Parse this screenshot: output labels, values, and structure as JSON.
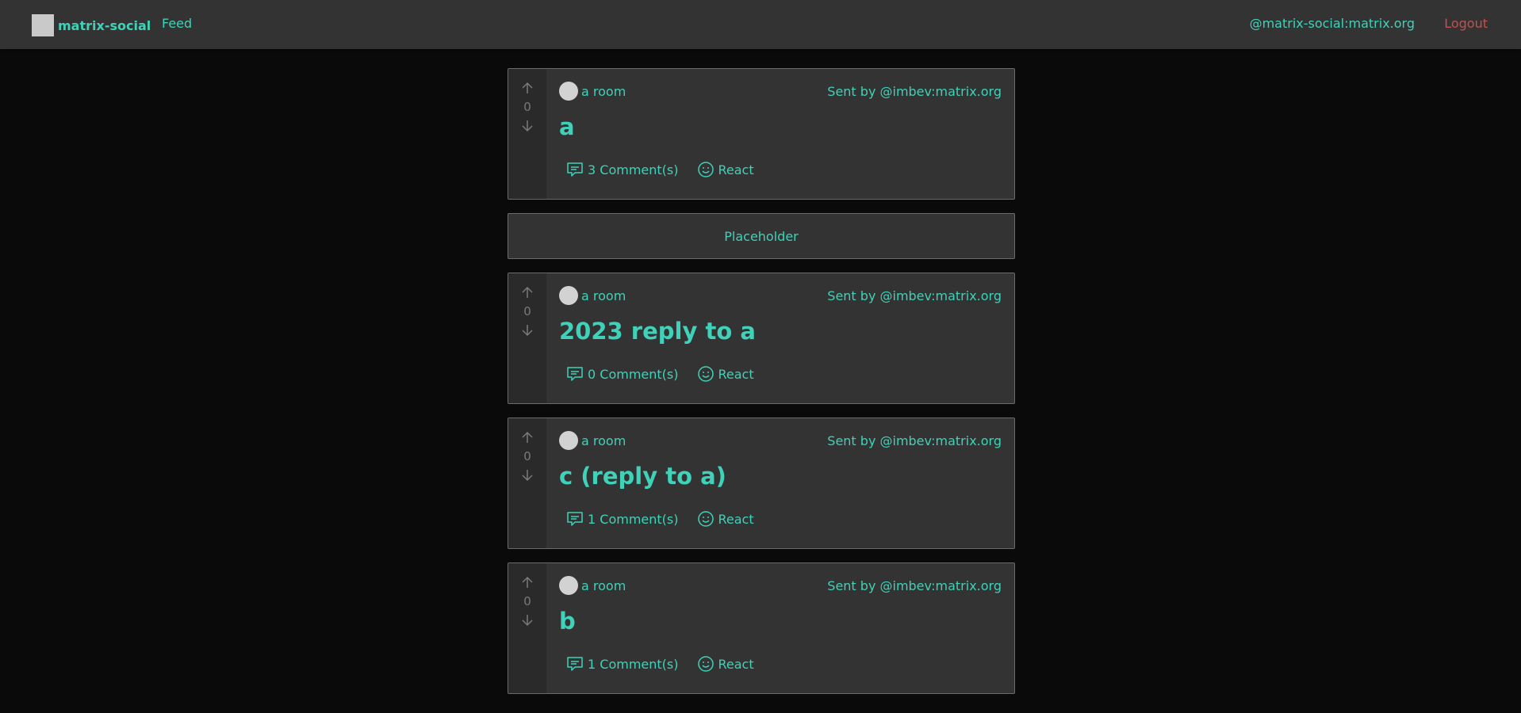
{
  "header": {
    "brand": "matrix-social",
    "nav_feed": "Feed",
    "user": "@matrix-social:matrix.org",
    "logout": "Logout"
  },
  "posts_a": {
    "room": "a room",
    "sender": "Sent by @imbev:matrix.org",
    "title": "a",
    "votes": "0",
    "comments": "3 Comment(s)",
    "react": "React"
  },
  "placeholder": "Placeholder",
  "posts_b": {
    "room": "a room",
    "sender": "Sent by @imbev:matrix.org",
    "title": "2023 reply to a",
    "votes": "0",
    "comments": "0 Comment(s)",
    "react": "React"
  },
  "posts_c": {
    "room": "a room",
    "sender": "Sent by @imbev:matrix.org",
    "title": "c (reply to a)",
    "votes": "0",
    "comments": "1 Comment(s)",
    "react": "React"
  },
  "posts_d": {
    "room": "a room",
    "sender": "Sent by @imbev:matrix.org",
    "title": "b",
    "votes": "0",
    "comments": "1 Comment(s)",
    "react": "React"
  },
  "colors": {
    "accent": "#3fd2b8",
    "logout": "#c94e4e",
    "background": "#0a0a0a",
    "card": "#333334"
  }
}
